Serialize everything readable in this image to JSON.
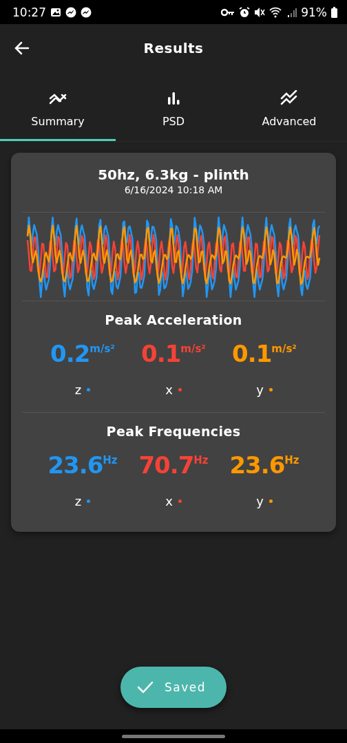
{
  "status_bar": {
    "time": "10:27",
    "battery": "91%"
  },
  "app_bar": {
    "title": "Results"
  },
  "tabs": [
    {
      "label": "Summary",
      "selected": true
    },
    {
      "label": "PSD",
      "selected": false
    },
    {
      "label": "Advanced",
      "selected": false
    }
  ],
  "card": {
    "title": "50hz, 6.3kg - plinth",
    "date": "6/16/2024 10:18 AM",
    "sections": [
      {
        "title": "Peak Acceleration",
        "metrics": [
          {
            "value": "0.2",
            "unit": "m/s²",
            "axis": "z",
            "color": "#2196f3"
          },
          {
            "value": "0.1",
            "unit": "m/s²",
            "axis": "x",
            "color": "#f44336"
          },
          {
            "value": "0.1",
            "unit": "m/s²",
            "axis": "y",
            "color": "#ff9800"
          }
        ]
      },
      {
        "title": "Peak Frequencies",
        "metrics": [
          {
            "value": "23.6",
            "unit": "Hz",
            "axis": "z",
            "color": "#2196f3"
          },
          {
            "value": "70.7",
            "unit": "Hz",
            "axis": "x",
            "color": "#f44336"
          },
          {
            "value": "23.6",
            "unit": "Hz",
            "axis": "y",
            "color": "#ff9800"
          }
        ]
      }
    ]
  },
  "save_button": {
    "label": "Saved",
    "saved": true
  }
}
